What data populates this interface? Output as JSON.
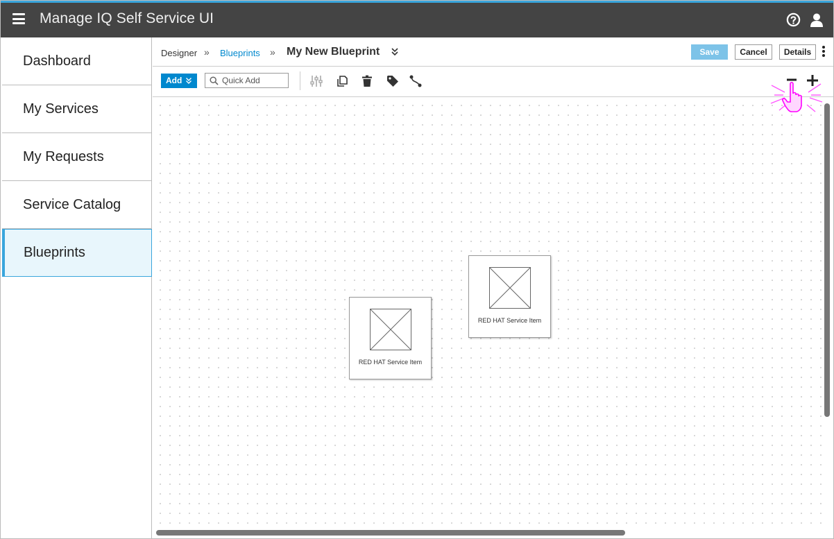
{
  "app": {
    "title": "Manage IQ Self Service UI"
  },
  "icons": {
    "menu": "hamburger-icon",
    "help": "help-icon",
    "user": "user-icon"
  },
  "sidebar": {
    "items": [
      {
        "label": "Dashboard",
        "active": false
      },
      {
        "label": "My Services",
        "active": false
      },
      {
        "label": "My Requests",
        "active": false
      },
      {
        "label": "Service Catalog",
        "active": false
      },
      {
        "label": "Blueprints",
        "active": true
      }
    ]
  },
  "breadcrumb": {
    "root": "Designer",
    "section": "Blueprints",
    "separator": "»",
    "title": "My New Blueprint"
  },
  "header_actions": {
    "save_label": "Save",
    "cancel_label": "Cancel",
    "details_label": "Details"
  },
  "toolbar": {
    "add_label": "Add",
    "quick_add_placeholder": "Quick Add",
    "tools": [
      "sliders-icon",
      "copy-icon",
      "trash-icon",
      "tag-icon",
      "connect-icon"
    ],
    "zoom": [
      "zoom-out-icon",
      "zoom-in-icon"
    ]
  },
  "canvas": {
    "nodes": [
      {
        "label": "RED HAT Service Item"
      },
      {
        "label": "RED HAT Service Item"
      }
    ]
  },
  "colors": {
    "accent": "#0088ce",
    "header_bg": "#444444",
    "active_nav_bg": "#e8f6fc",
    "save_disabled": "#7dc3e8",
    "cursor_highlight": "#ff00ff"
  }
}
